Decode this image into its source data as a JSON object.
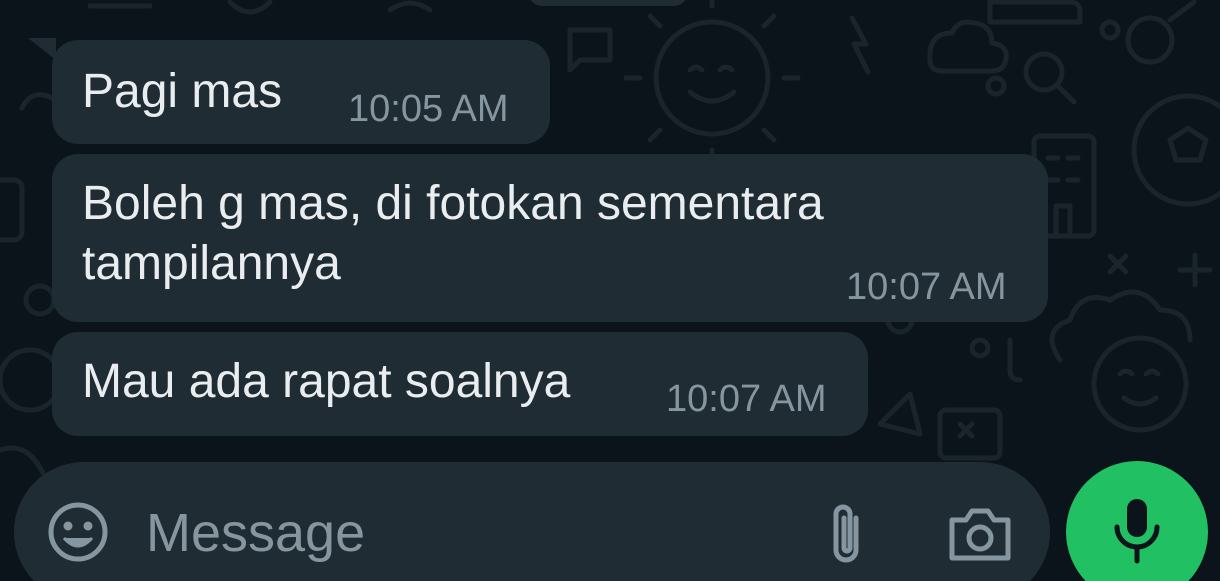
{
  "messages": [
    {
      "text": "Pagi mas",
      "time": "10:05 AM"
    },
    {
      "text": "Boleh g mas, di fotokan sementara\ntampilannya",
      "time": "10:07 AM"
    },
    {
      "text": "Mau ada rapat soalnya",
      "time": "10:07 AM"
    }
  ],
  "composer": {
    "placeholder": "Message",
    "icons": [
      "emoji-icon",
      "attach-icon",
      "camera-icon",
      "mic-icon"
    ]
  },
  "colors": {
    "background": "#0b141a",
    "bubble": "#202c33",
    "text": "#e9edef",
    "meta": "#8696a0",
    "accent": "#21c063"
  }
}
